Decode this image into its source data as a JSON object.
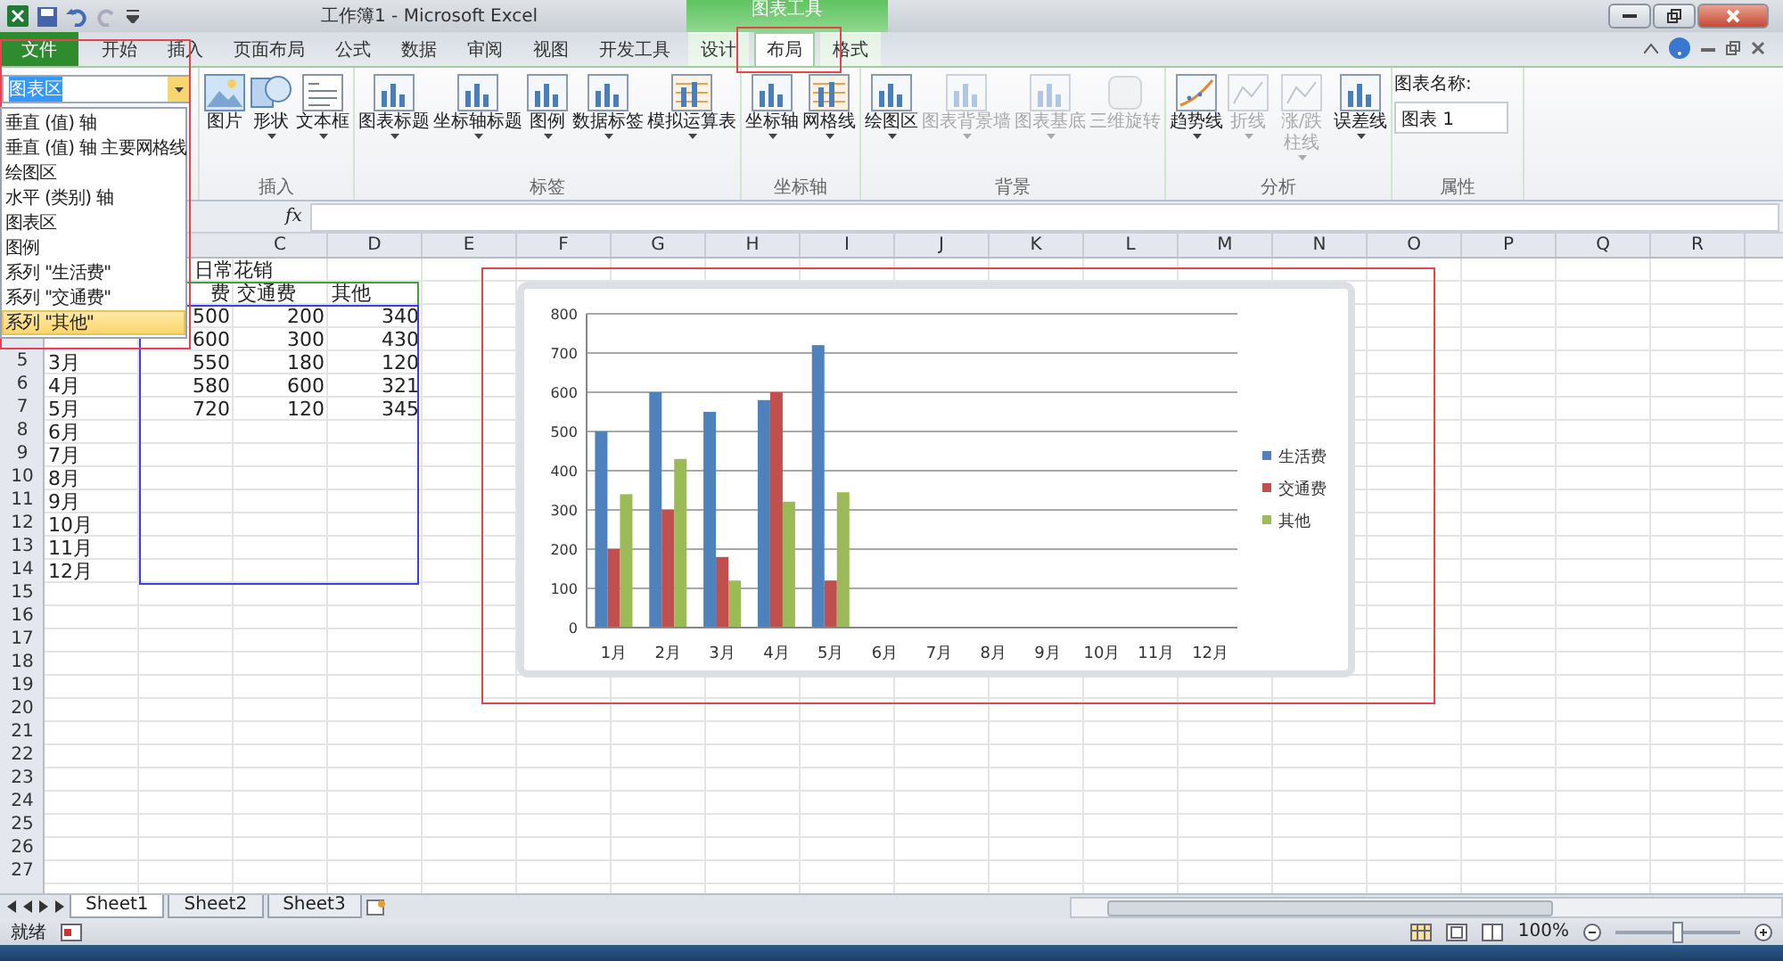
{
  "title_bar": {
    "title": "工作簿1 - Microsoft Excel"
  },
  "context_tab_group": {
    "label": "图表工具"
  },
  "tabs": [
    {
      "label": "文件",
      "kind": "file",
      "selected": false
    },
    {
      "label": "开始",
      "kind": "normal",
      "selected": false
    },
    {
      "label": "插入",
      "kind": "normal",
      "selected": false
    },
    {
      "label": "页面布局",
      "kind": "normal",
      "selected": false
    },
    {
      "label": "公式",
      "kind": "normal",
      "selected": false
    },
    {
      "label": "数据",
      "kind": "normal",
      "selected": false
    },
    {
      "label": "审阅",
      "kind": "normal",
      "selected": false
    },
    {
      "label": "视图",
      "kind": "normal",
      "selected": false
    },
    {
      "label": "开发工具",
      "kind": "normal",
      "selected": false
    },
    {
      "label": "设计",
      "kind": "context",
      "selected": false
    },
    {
      "label": "布局",
      "kind": "context",
      "selected": true
    },
    {
      "label": "格式",
      "kind": "context",
      "selected": false
    }
  ],
  "ribbon": {
    "selection": {
      "value": "图表区"
    },
    "groups": [
      {
        "label": "插入",
        "buttons": [
          {
            "label": "图片",
            "kind": "picture",
            "menu": false,
            "disabled": false
          },
          {
            "label": "形状",
            "kind": "shapes",
            "menu": true,
            "disabled": false
          },
          {
            "label": "文本框",
            "kind": "textbox",
            "menu": true,
            "disabled": false
          }
        ]
      },
      {
        "label": "标签",
        "buttons": [
          {
            "label": "图表标题",
            "kind": "chart",
            "menu": true,
            "disabled": false
          },
          {
            "label": "坐标轴标题",
            "kind": "chart",
            "menu": true,
            "disabled": false
          },
          {
            "label": "图例",
            "kind": "chart",
            "menu": true,
            "disabled": false
          },
          {
            "label": "数据标签",
            "kind": "chart",
            "menu": true,
            "disabled": false
          },
          {
            "label": "模拟运算表",
            "kind": "grid",
            "menu": true,
            "disabled": false
          }
        ]
      },
      {
        "label": "坐标轴",
        "buttons": [
          {
            "label": "坐标轴",
            "kind": "chart",
            "menu": true,
            "disabled": false
          },
          {
            "label": "网格线",
            "kind": "grid",
            "menu": true,
            "disabled": false
          }
        ]
      },
      {
        "label": "背景",
        "buttons": [
          {
            "label": "绘图区",
            "kind": "chart",
            "menu": true,
            "disabled": false
          },
          {
            "label": "图表背景墙",
            "kind": "chart",
            "menu": true,
            "disabled": true
          },
          {
            "label": "图表基底",
            "kind": "chart",
            "menu": true,
            "disabled": true
          },
          {
            "label": "三维旋转",
            "kind": "cube",
            "menu": false,
            "disabled": true
          }
        ]
      },
      {
        "label": "分析",
        "buttons": [
          {
            "label": "趋势线",
            "kind": "trend",
            "menu": true,
            "disabled": false
          },
          {
            "label": "折线",
            "kind": "line",
            "menu": true,
            "disabled": true
          },
          {
            "label": "涨/跌柱线",
            "kind": "line",
            "menu": true,
            "disabled": true
          },
          {
            "label": "误差线",
            "kind": "chart",
            "menu": true,
            "disabled": false
          }
        ]
      }
    ],
    "properties": {
      "label": "属性",
      "field_label": "图表名称:",
      "value": "图表 1"
    }
  },
  "element_list": {
    "items": [
      {
        "label": "垂直 (值) 轴",
        "selected": false
      },
      {
        "label": "垂直 (值) 轴 主要网格线",
        "selected": false
      },
      {
        "label": "绘图区",
        "selected": false
      },
      {
        "label": "水平 (类别) 轴",
        "selected": false
      },
      {
        "label": "图表区",
        "selected": false
      },
      {
        "label": "图例",
        "selected": false
      },
      {
        "label": "系列 \"生活费\"",
        "selected": false
      },
      {
        "label": "系列 \"交通费\"",
        "selected": false
      },
      {
        "label": "系列 \"其他\"",
        "selected": true
      }
    ]
  },
  "formula_bar": {
    "function_label": "fx"
  },
  "sheet": {
    "columns": [
      "C",
      "D",
      "E",
      "F",
      "G",
      "H",
      "I",
      "J",
      "K",
      "L",
      "M",
      "N",
      "O",
      "P",
      "Q",
      "R"
    ],
    "rows": [
      {
        "kind": "title",
        "text": "日常花销"
      },
      {
        "kind": "header",
        "B": "费",
        "C": "交通费",
        "D": "其他"
      },
      {
        "kind": "data",
        "B": "500",
        "C": "200",
        "D": "340"
      },
      {
        "kind": "data",
        "B": "600",
        "C": "300",
        "D": "430"
      },
      {
        "kind": "data",
        "number": "5",
        "A": "3月",
        "B": "550",
        "C": "180",
        "D": "120"
      },
      {
        "kind": "data",
        "number": "6",
        "A": "4月",
        "B": "580",
        "C": "600",
        "D": "321"
      },
      {
        "kind": "data",
        "number": "7",
        "A": "5月",
        "B": "720",
        "C": "120",
        "D": "345"
      },
      {
        "kind": "data",
        "number": "8",
        "A": "6月"
      },
      {
        "kind": "data",
        "number": "9",
        "A": "7月"
      },
      {
        "kind": "data",
        "number": "10",
        "A": "8月"
      },
      {
        "kind": "data",
        "number": "11",
        "A": "9月"
      },
      {
        "kind": "data",
        "number": "12",
        "A": "10月"
      },
      {
        "kind": "data",
        "number": "13",
        "A": "11月"
      },
      {
        "kind": "data",
        "number": "14",
        "A": "12月"
      },
      {
        "kind": "data",
        "number": "15"
      },
      {
        "kind": "data",
        "number": "16"
      },
      {
        "kind": "data",
        "number": "17"
      },
      {
        "kind": "data",
        "number": "18"
      },
      {
        "kind": "data",
        "number": "19"
      },
      {
        "kind": "data",
        "number": "20"
      },
      {
        "kind": "data",
        "number": "21"
      },
      {
        "kind": "data",
        "number": "22"
      },
      {
        "kind": "data",
        "number": "23"
      },
      {
        "kind": "data",
        "number": "24"
      },
      {
        "kind": "data",
        "number": "25"
      },
      {
        "kind": "data",
        "number": "26"
      },
      {
        "kind": "data",
        "number": "27"
      }
    ]
  },
  "chart": {
    "chart_data": {
      "type": "bar",
      "categories": [
        "1月",
        "2月",
        "3月",
        "4月",
        "5月",
        "6月",
        "7月",
        "8月",
        "9月",
        "10月",
        "11月",
        "12月"
      ],
      "series": [
        {
          "name": "生活费",
          "color": "#4f81bd",
          "values": [
            500,
            600,
            550,
            580,
            720,
            null,
            null,
            null,
            null,
            null,
            null,
            null
          ]
        },
        {
          "name": "交通费",
          "color": "#c0504d",
          "values": [
            200,
            300,
            180,
            600,
            120,
            null,
            null,
            null,
            null,
            null,
            null,
            null
          ]
        },
        {
          "name": "其他",
          "color": "#9bbb59",
          "values": [
            340,
            430,
            120,
            321,
            345,
            null,
            null,
            null,
            null,
            null,
            null,
            null
          ]
        }
      ],
      "ylim": [
        0,
        800
      ],
      "yticks": [
        0,
        100,
        200,
        300,
        400,
        500,
        600,
        700,
        800
      ],
      "grid": true,
      "legend": true
    }
  },
  "sheet_tabs": [
    {
      "label": "Sheet1",
      "selected": true
    },
    {
      "label": "Sheet2",
      "selected": false
    },
    {
      "label": "Sheet3",
      "selected": false
    }
  ],
  "status_bar": {
    "status": "就绪",
    "zoom": "100%",
    "zoom_slider": {
      "level": 0.5
    }
  }
}
